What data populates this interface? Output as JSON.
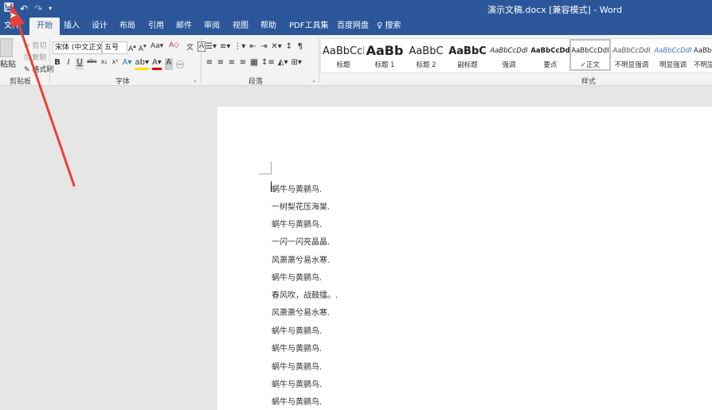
{
  "app": {
    "title": "演示文稿.docx [兼容模式] - Word",
    "brand_color": "#2b579a"
  },
  "qat": {
    "save_icon": "save-icon",
    "undo_icon": "undo-icon",
    "redo_icon": "redo-icon",
    "customize_icon": "customize-icon"
  },
  "tabs": [
    {
      "label": "文件"
    },
    {
      "label": "开始"
    },
    {
      "label": "插入"
    },
    {
      "label": "设计"
    },
    {
      "label": "布局"
    },
    {
      "label": "引用"
    },
    {
      "label": "邮件"
    },
    {
      "label": "审阅"
    },
    {
      "label": "视图"
    },
    {
      "label": "帮助"
    },
    {
      "label": "PDF工具集"
    },
    {
      "label": "百度网盘"
    },
    {
      "label": "搜索"
    }
  ],
  "ribbon": {
    "clipboard": {
      "group_label": "剪贴板",
      "paste": "粘贴",
      "cut": "剪切",
      "copy": "复制",
      "format_painter": "格式刷"
    },
    "font": {
      "group_label": "字体",
      "font_name": "宋体 (中文正文)",
      "font_size": "五号",
      "bold": "B",
      "italic": "I",
      "underline": "U",
      "strikethrough": "abc",
      "subscript": "x₂",
      "superscript": "x²"
    },
    "paragraph": {
      "group_label": "段落"
    },
    "styles": {
      "group_label": "样式",
      "items": [
        {
          "preview": "AaBbCcI",
          "name": "标题"
        },
        {
          "preview": "AaBb",
          "name": "标题 1"
        },
        {
          "preview": "AaBbC",
          "name": "标题 2"
        },
        {
          "preview": "AaBbC",
          "name": "副标题"
        },
        {
          "preview": "AaBbCcDdI",
          "name": "强调"
        },
        {
          "preview": "AaBbCcDd",
          "name": "要点"
        },
        {
          "preview": "AaBbCcDdI",
          "name": "正文",
          "selected": true
        },
        {
          "preview": "AaBbCcDdI",
          "name": "不明显强调"
        },
        {
          "preview": "AaBbCcDdI",
          "name": "明显强调"
        },
        {
          "preview": "AaBbC",
          "name": "不明显"
        }
      ]
    }
  },
  "document": {
    "lines": [
      "蜗牛与黄鹂鸟.",
      "一树梨花压海棠.",
      "蜗牛与黄鹂鸟.",
      "一闪一闪亮晶晶.",
      "风萧萧兮易水寒.",
      "蜗牛与黄鹂鸟.",
      "春风吹，战鼓擂。.",
      "风萧萧兮易水寒.",
      "蜗牛与黄鹂鸟.",
      "蜗牛与黄鹂鸟.",
      "蜗牛与黄鹂鸟.",
      "蜗牛与黄鹂鸟.",
      "蜗牛与黄鹂鸟."
    ]
  },
  "annotation": {
    "arrow_color": "#e8413a"
  }
}
